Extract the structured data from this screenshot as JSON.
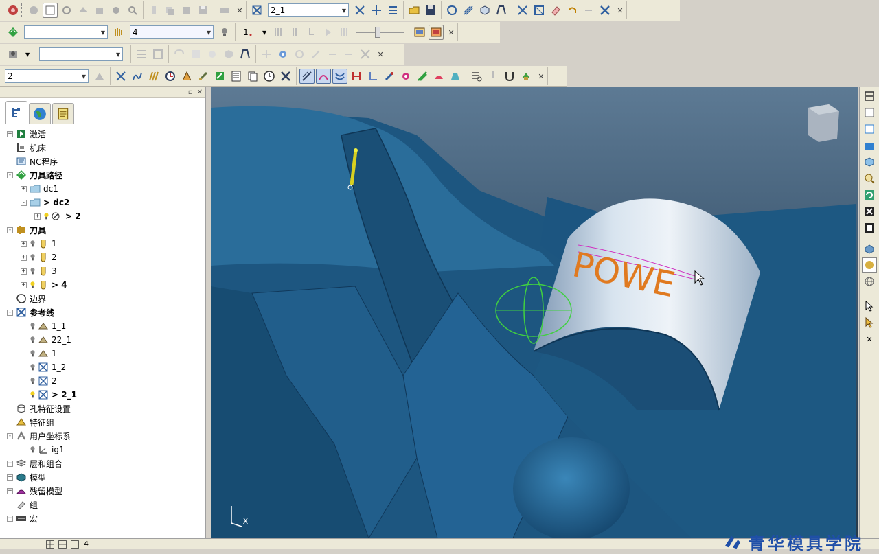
{
  "toolbar1": {
    "active_pattern": "2_1"
  },
  "toolbar2": {
    "layer_select": "",
    "tool_select": "4",
    "thickness_label": "1"
  },
  "toolbar3": {
    "select": ""
  },
  "toolbar4": {
    "select": "2"
  },
  "explorer": {
    "tree": [
      {
        "label": "激活",
        "level": 0,
        "exp": "+",
        "icon": "activate-icon",
        "bold": false
      },
      {
        "label": "机床",
        "level": 0,
        "exp": "",
        "icon": "machine-icon",
        "bold": false
      },
      {
        "label": "NC程序",
        "level": 0,
        "exp": "",
        "icon": "nc-program-icon",
        "bold": false
      },
      {
        "label": "刀具路径",
        "level": 0,
        "exp": "-",
        "icon": "toolpath-icon",
        "bold": true
      },
      {
        "label": "dc1",
        "level": 1,
        "exp": "+",
        "icon": "folder-icon",
        "bold": false
      },
      {
        "label": "> dc2",
        "level": 1,
        "exp": "-",
        "icon": "folder-icon",
        "bold": true
      },
      {
        "label": "> 2",
        "level": 2,
        "exp": "+",
        "icon": "toolpath-item-icon",
        "bold": true
      },
      {
        "label": "刀具",
        "level": 0,
        "exp": "-",
        "icon": "tool-icon",
        "bold": true
      },
      {
        "label": "1",
        "level": 1,
        "exp": "+",
        "icon": "cutter-icon",
        "bold": false
      },
      {
        "label": "2",
        "level": 1,
        "exp": "+",
        "icon": "cutter-icon",
        "bold": false
      },
      {
        "label": "3",
        "level": 1,
        "exp": "+",
        "icon": "cutter-icon",
        "bold": false
      },
      {
        "label": "> 4",
        "level": 1,
        "exp": "+",
        "icon": "cutter-icon",
        "bold": true
      },
      {
        "label": "边界",
        "level": 0,
        "exp": "",
        "icon": "boundary-icon",
        "bold": false
      },
      {
        "label": "参考线",
        "level": 0,
        "exp": "-",
        "icon": "pattern-icon",
        "bold": true
      },
      {
        "label": "1_1",
        "level": 1,
        "exp": "",
        "icon": "pattern-item-icon",
        "bold": false
      },
      {
        "label": "22_1",
        "level": 1,
        "exp": "",
        "icon": "pattern-item-icon",
        "bold": false
      },
      {
        "label": "1",
        "level": 1,
        "exp": "",
        "icon": "pattern-item-icon",
        "bold": false
      },
      {
        "label": "1_2",
        "level": 1,
        "exp": "",
        "icon": "pattern-x-icon",
        "bold": false
      },
      {
        "label": "2",
        "level": 1,
        "exp": "",
        "icon": "pattern-x-icon",
        "bold": false
      },
      {
        "label": "> 2_1",
        "level": 1,
        "exp": "",
        "icon": "pattern-x-icon",
        "bold": true
      },
      {
        "label": "孔特征设置",
        "level": 0,
        "exp": "",
        "icon": "hole-feature-icon",
        "bold": false
      },
      {
        "label": "特征组",
        "level": 0,
        "exp": "",
        "icon": "feature-group-icon",
        "bold": false
      },
      {
        "label": "用户坐标系",
        "level": 0,
        "exp": "-",
        "icon": "workplane-icon",
        "bold": false
      },
      {
        "label": "ig1",
        "level": 1,
        "exp": "",
        "icon": "workplane-item-icon",
        "bold": false
      },
      {
        "label": "层和组合",
        "level": 0,
        "exp": "+",
        "icon": "layers-icon",
        "bold": false
      },
      {
        "label": "模型",
        "level": 0,
        "exp": "+",
        "icon": "model-icon",
        "bold": false
      },
      {
        "label": "残留模型",
        "level": 0,
        "exp": "+",
        "icon": "stock-model-icon",
        "bold": false
      },
      {
        "label": "组",
        "level": 0,
        "exp": "",
        "icon": "group-icon",
        "bold": false
      },
      {
        "label": "宏",
        "level": 0,
        "exp": "+",
        "icon": "macro-icon",
        "bold": false
      }
    ]
  },
  "viewport": {
    "axis_label": "X",
    "engraved_text": "POWE"
  },
  "status": {
    "text": "4"
  },
  "brand": {
    "text": "青华模具学院"
  },
  "colors": {
    "model_blue": "#1e5a84",
    "cylinder": "#c6d6e6",
    "toolpath_orange": "#e07a20",
    "toolpath_magenta": "#d030c0",
    "tool_yellow": "#d8d020"
  }
}
